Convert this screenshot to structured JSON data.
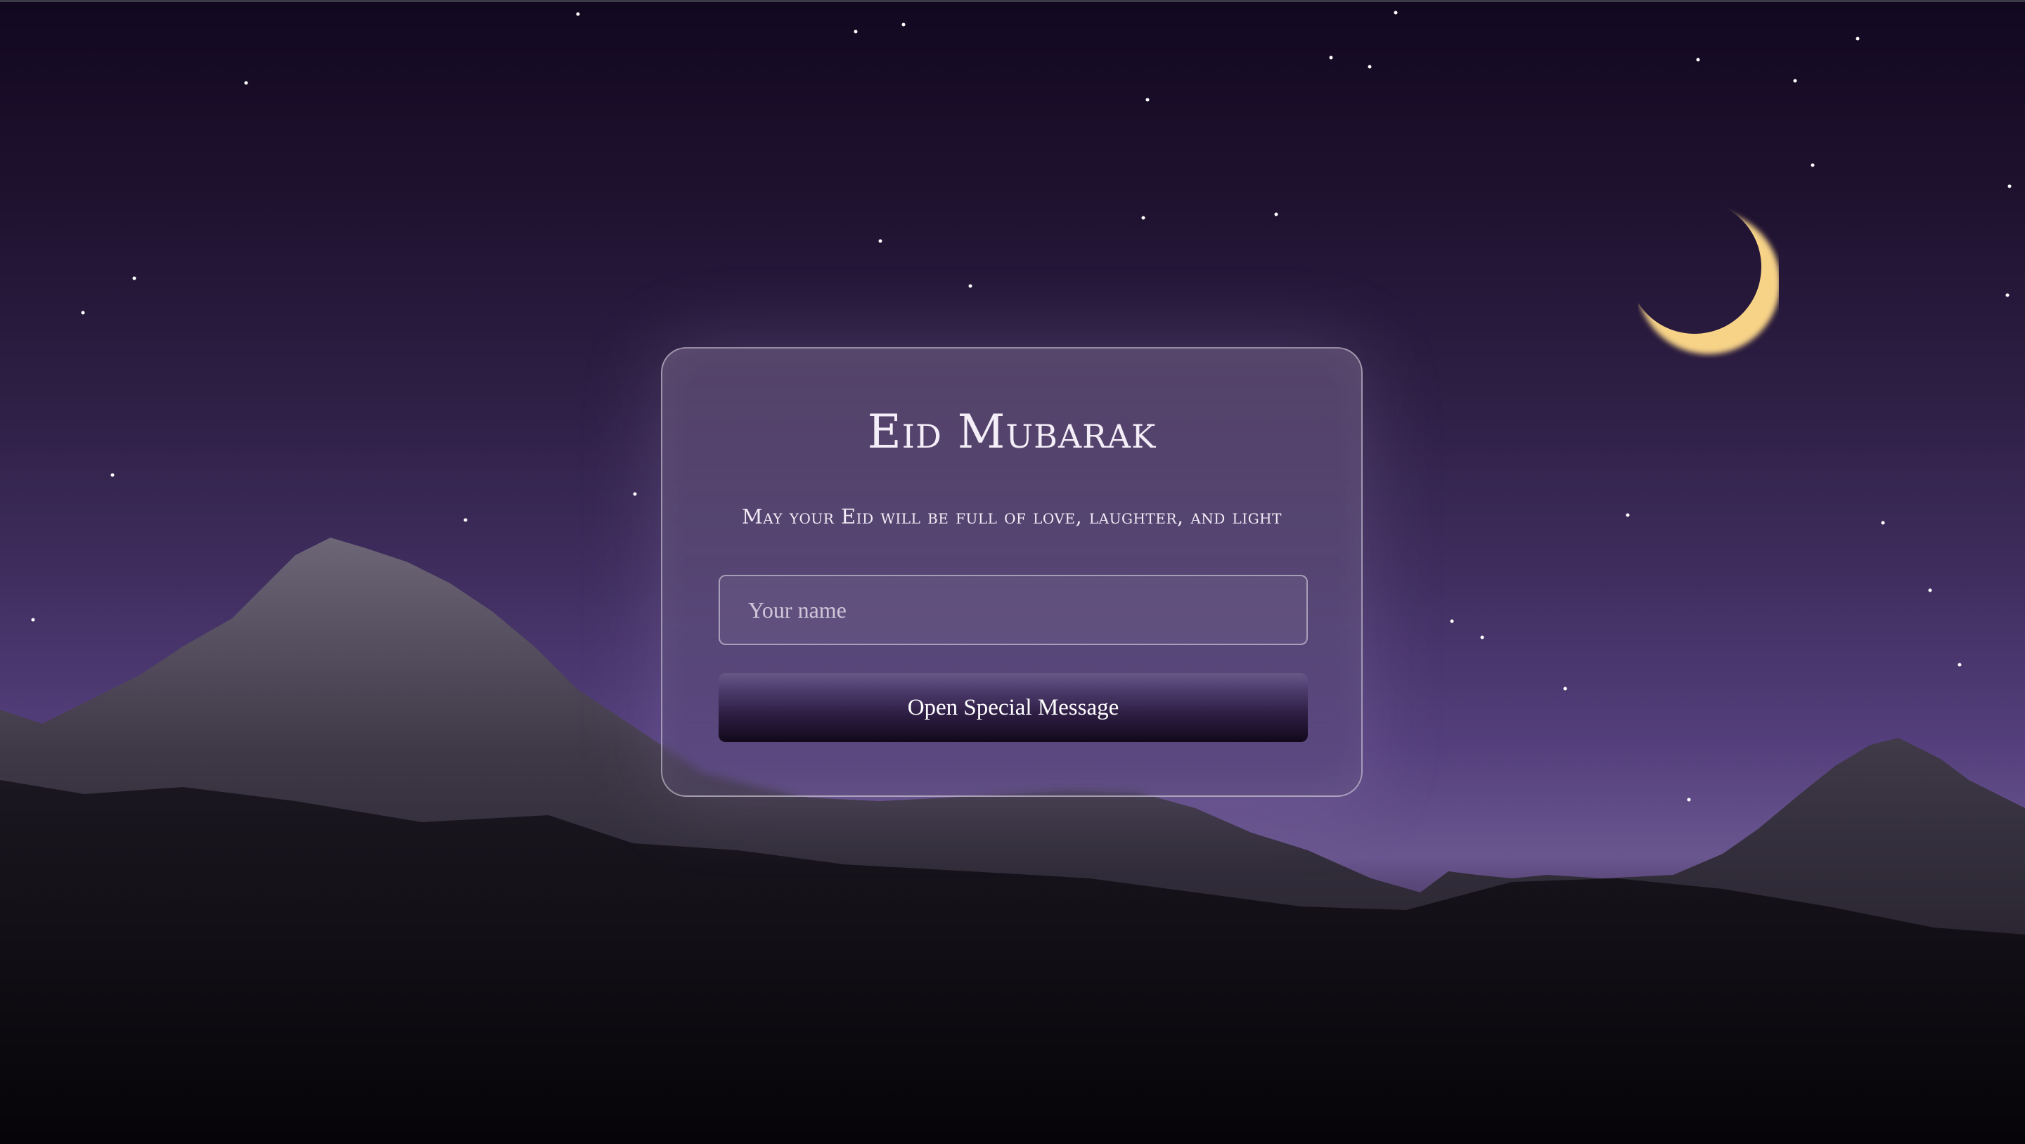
{
  "greeting": {
    "title": "Eid Mubarak",
    "subtitle": "May your Eid will be full of love, laughter, and light",
    "name_placeholder": "Your name",
    "button_label": "Open Special Message"
  },
  "colors": {
    "sky_top": "#120820",
    "sky_horizon": "#6a568f",
    "moon": "#f7d387",
    "button_top": "#675887",
    "button_bottom": "#12091c"
  }
}
